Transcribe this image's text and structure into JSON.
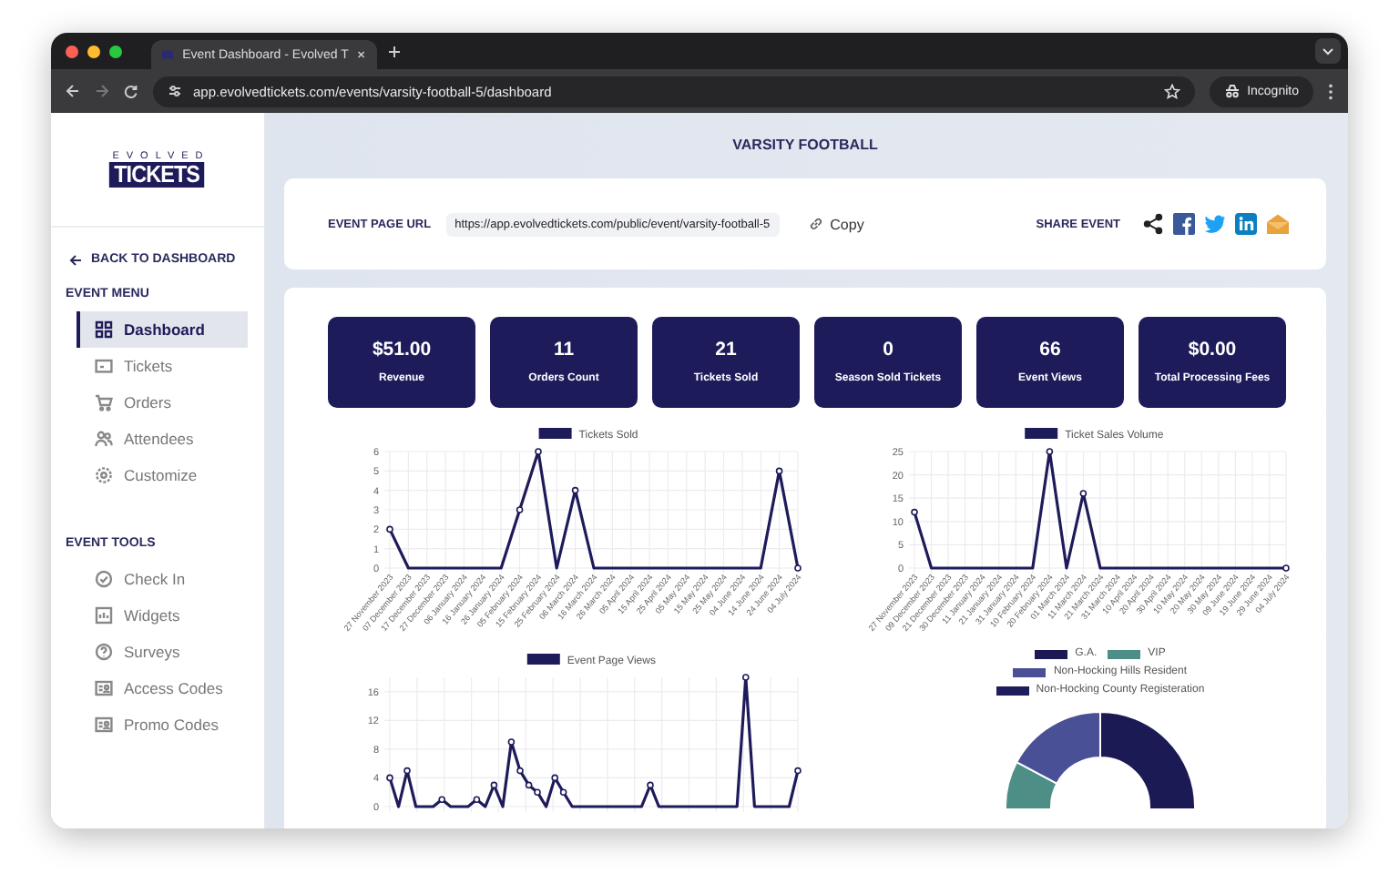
{
  "browser": {
    "tab_title": "Event Dashboard - Evolved T",
    "url": "app.evolvedtickets.com/events/varsity-football-5/dashboard",
    "profile": "Incognito"
  },
  "sidebar": {
    "logo_top": "EVOLVED",
    "logo_main": "TICKETS",
    "back": "BACK TO DASHBOARD",
    "sections": [
      {
        "title": "EVENT MENU",
        "items": [
          {
            "label": "Dashboard",
            "kind": "grid",
            "selected": true
          },
          {
            "label": "Tickets",
            "kind": "ticket",
            "selected": false
          },
          {
            "label": "Orders",
            "kind": "cart",
            "selected": false
          },
          {
            "label": "Attendees",
            "kind": "people",
            "selected": false
          },
          {
            "label": "Customize",
            "kind": "gear",
            "selected": false
          }
        ]
      },
      {
        "title": "EVENT TOOLS",
        "items": [
          {
            "label": "Check In",
            "kind": "check",
            "selected": false
          },
          {
            "label": "Widgets",
            "kind": "widget",
            "selected": false
          },
          {
            "label": "Surveys",
            "kind": "question",
            "selected": false
          },
          {
            "label": "Access Codes",
            "kind": "code",
            "selected": false
          },
          {
            "label": "Promo Codes",
            "kind": "code",
            "selected": false
          }
        ]
      }
    ]
  },
  "page": {
    "title": "VARSITY FOOTBALL"
  },
  "event_url": {
    "label": "EVENT PAGE URL",
    "value": "https://app.evolvedtickets.com/public/event/varsity-football-5",
    "copy": "Copy",
    "share_label": "SHARE EVENT",
    "share": [
      {
        "kind": "share"
      },
      {
        "kind": "facebook"
      },
      {
        "kind": "twitter"
      },
      {
        "kind": "linkedin"
      },
      {
        "kind": "email"
      }
    ]
  },
  "stats": [
    {
      "value": "$51.00",
      "label": "Revenue"
    },
    {
      "value": "11",
      "label": "Orders Count"
    },
    {
      "value": "21",
      "label": "Tickets Sold"
    },
    {
      "value": "0",
      "label": "Season Sold Tickets"
    },
    {
      "value": "66",
      "label": "Event Views"
    },
    {
      "value": "$0.00",
      "label": "Total Processing Fees"
    }
  ],
  "charts": [
    {
      "chart_data": {
        "type": "line",
        "grid": true,
        "categories": [
          "27 November 2023",
          "07 December 2023",
          "17 December 2023",
          "27 December 2023",
          "06 January 2024",
          "16 January 2024",
          "26 January 2024",
          "05 February 2024",
          "15 February 2024",
          "25 February 2024",
          "06 March 2024",
          "16 March 2024",
          "26 March 2024",
          "05 April 2024",
          "15 April 2024",
          "25 April 2024",
          "05 May 2024",
          "15 May 2024",
          "25 May 2024",
          "04 June 2024",
          "14 June 2024",
          "24 June 2024",
          "04 July 2024"
        ],
        "ylim": [
          0,
          6
        ],
        "yticks": [
          0,
          1,
          2,
          3,
          4,
          5,
          6
        ],
        "series": [
          {
            "name": "Tickets Sold",
            "color": "#1e1b5a",
            "values": [
              2,
              0,
              0,
              0,
              0,
              0,
              0,
              3,
              6,
              0,
              4,
              0,
              0,
              0,
              0,
              0,
              0,
              0,
              0,
              0,
              0,
              5,
              0
            ]
          }
        ]
      }
    },
    {
      "chart_data": {
        "type": "line",
        "grid": true,
        "categories": [
          "27 November 2023",
          "09 December 2023",
          "21 December 2023",
          "30 December 2023",
          "11 January 2024",
          "21 January 2024",
          "31 January 2024",
          "10 February 2024",
          "20 February 2024",
          "01 March 2024",
          "11 March 2024",
          "21 March 2024",
          "31 March 2024",
          "10 April 2024",
          "20 April 2024",
          "30 April 2024",
          "10 May 2024",
          "20 May 2024",
          "30 May 2024",
          "09 June 2024",
          "19 June 2024",
          "29 June 2024",
          "04 July 2024"
        ],
        "ylim": [
          0,
          25
        ],
        "yticks": [
          0,
          5,
          10,
          15,
          20,
          25
        ],
        "series": [
          {
            "name": "Ticket Sales Volume",
            "color": "#1e1b5a",
            "values": [
              12,
              0,
              0,
              0,
              0,
              0,
              0,
              0,
              25,
              0,
              16,
              0,
              0,
              0,
              0,
              0,
              0,
              0,
              0,
              0,
              0,
              0,
              0
            ]
          }
        ]
      }
    },
    {
      "chart_data": {
        "type": "line",
        "grid": true,
        "ylim": [
          0,
          18
        ],
        "yticks": [
          0,
          4,
          8,
          12,
          16
        ],
        "series": [
          {
            "name": "Event Page Views",
            "color": "#1e1b5a",
            "values": [
              4,
              0,
              5,
              0,
              0,
              0,
              1,
              0,
              0,
              0,
              1,
              0,
              3,
              0,
              9,
              5,
              3,
              2,
              0,
              4,
              2,
              0,
              0,
              0,
              0,
              0,
              0,
              0,
              0,
              0,
              3,
              0,
              0,
              0,
              0,
              0,
              0,
              0,
              0,
              0,
              0,
              18,
              0,
              0,
              0,
              0,
              0,
              5
            ]
          }
        ]
      }
    }
  ],
  "ticket_types": {
    "legend": [
      {
        "label": "G.A.",
        "color": "#1c1a55"
      },
      {
        "label": "VIP",
        "color": "#4d8f86"
      },
      {
        "label": "Non-Hocking Hills Resident",
        "color": "#4a5096"
      },
      {
        "label": "Non-Hocking County Registeration",
        "color": "#201d5c"
      }
    ]
  }
}
